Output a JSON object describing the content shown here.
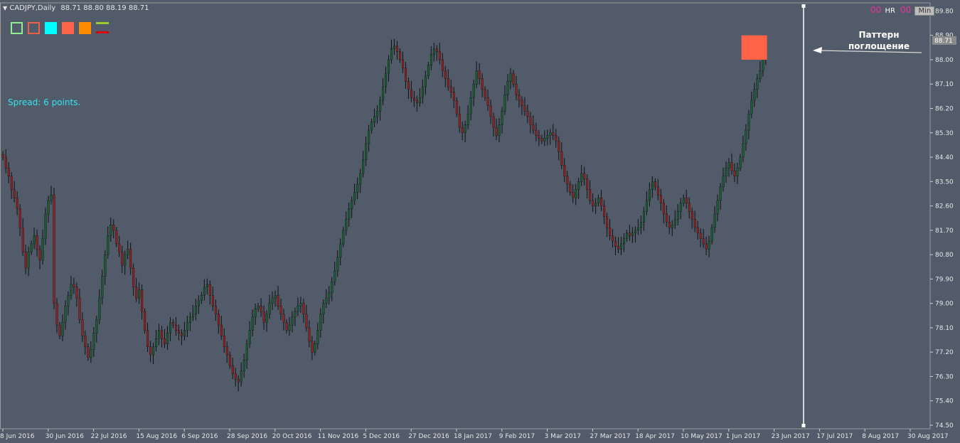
{
  "header": {
    "title": "CADJPY,Daily",
    "ohlc": "88.71 88.80 88.19 88.71"
  },
  "toolbar": {
    "buttons": [
      {
        "name": "green-outline-square",
        "color": "#90ee90",
        "style": "outline"
      },
      {
        "name": "red-outline-square",
        "color": "#f06048",
        "style": "outline"
      },
      {
        "name": "cyan-square",
        "color": "#00ffff",
        "style": "fill"
      },
      {
        "name": "tomato-square",
        "color": "#ff6347",
        "style": "fill"
      },
      {
        "name": "orange-square",
        "color": "#ff8c00",
        "style": "fill"
      },
      {
        "name": "lines-button",
        "colors": [
          "#9acd32",
          "#dd0000"
        ],
        "style": "lines"
      }
    ]
  },
  "spread": {
    "text": "Spread: 6 points."
  },
  "top_right": {
    "hr_counter": "00",
    "hr_label": "HR",
    "min_counter": "00",
    "min_label": "Min"
  },
  "annotation": {
    "line1": "Паттерн",
    "line2": "поглощение"
  },
  "current_price_label": "88.71",
  "colors": {
    "background": "#525b69",
    "bull": "#1a5c33",
    "bear": "#8e2222",
    "wick": "#101010",
    "pattern_box": "#ff6347",
    "vline": "#ffffff",
    "axis_text": "#e6e6e6",
    "spread_text": "#35e3f0",
    "counter_text": "#e8349b"
  },
  "chart_data": {
    "type": "candlestick",
    "title": "CADJPY,Daily",
    "y_ticks": [
      "89.80",
      "88.90",
      "88.00",
      "87.10",
      "86.20",
      "85.30",
      "84.40",
      "83.50",
      "82.60",
      "81.70",
      "80.80",
      "79.90",
      "79.00",
      "78.10",
      "77.20",
      "76.30",
      "75.40",
      "74.50"
    ],
    "ylim": [
      74.5,
      90.1
    ],
    "x_ticks": [
      "8 Jun 2016",
      "30 Jun 2016",
      "22 Jul 2016",
      "15 Aug 2016",
      "6 Sep 2016",
      "28 Sep 2016",
      "20 Oct 2016",
      "11 Nov 2016",
      "5 Dec 2016",
      "27 Dec 2016",
      "18 Jan 2017",
      "9 Feb 2017",
      "3 Mar 2017",
      "27 Mar 2017",
      "18 Apr 2017",
      "10 May 2017",
      "1 Jun 2017",
      "23 Jun 2017",
      "17 Jul 2017",
      "8 Aug 2017",
      "30 Aug 2017"
    ],
    "bars_between_ticks": 16,
    "series_close": [
      84.4,
      84.0,
      83.7,
      83.2,
      82.9,
      82.5,
      81.8,
      80.9,
      80.3,
      80.9,
      81.2,
      81.5,
      81.0,
      80.6,
      81.4,
      82.3,
      82.8,
      83.0,
      79.0,
      78.2,
      77.8,
      78.3,
      78.9,
      79.3,
      79.7,
      79.6,
      79.2,
      78.4,
      77.8,
      77.4,
      77.0,
      77.3,
      77.9,
      78.4,
      79.2,
      80.0,
      80.8,
      81.5,
      81.9,
      81.7,
      81.2,
      80.9,
      80.4,
      80.8,
      81.0,
      80.3,
      79.6,
      79.2,
      79.5,
      78.7,
      78.0,
      77.4,
      77.1,
      77.4,
      77.7,
      78.0,
      77.7,
      77.5,
      77.9,
      78.3,
      78.2,
      78.0,
      77.9,
      77.8,
      78.0,
      78.3,
      78.5,
      78.6,
      78.9,
      79.1,
      79.3,
      79.6,
      79.7,
      79.3,
      78.9,
      78.6,
      78.2,
      77.8,
      77.4,
      77.1,
      76.7,
      76.4,
      76.2,
      76.1,
      76.5,
      76.9,
      77.5,
      78.0,
      78.5,
      78.8,
      78.9,
      78.7,
      78.3,
      78.6,
      79.0,
      79.2,
      79.3,
      78.9,
      78.6,
      78.3,
      78.0,
      78.2,
      78.5,
      78.7,
      78.9,
      79.0,
      78.6,
      78.1,
      77.6,
      77.2,
      77.5,
      78.0,
      78.6,
      79.0,
      79.2,
      79.4,
      79.8,
      80.2,
      80.7,
      81.2,
      81.7,
      82.1,
      82.5,
      82.8,
      83.1,
      83.4,
      83.8,
      84.3,
      84.9,
      85.4,
      85.7,
      85.9,
      86.1,
      86.5,
      87.0,
      87.5,
      88.0,
      88.4,
      88.5,
      88.3,
      88.0,
      87.7,
      87.2,
      86.9,
      86.6,
      86.5,
      86.4,
      86.6,
      87.0,
      87.4,
      87.8,
      88.2,
      88.4,
      88.3,
      88.0,
      87.6,
      87.3,
      87.0,
      86.8,
      86.5,
      86.0,
      85.5,
      85.3,
      85.6,
      86.0,
      86.6,
      87.1,
      87.6,
      87.3,
      86.9,
      86.6,
      86.3,
      85.9,
      85.5,
      85.2,
      85.6,
      86.1,
      86.7,
      87.2,
      87.5,
      87.1,
      86.7,
      86.5,
      86.3,
      86.1,
      85.9,
      85.6,
      85.4,
      85.2,
      85.1,
      85.0,
      85.1,
      85.2,
      85.3,
      85.2,
      85.0,
      84.6,
      84.1,
      83.7,
      83.4,
      83.1,
      82.9,
      83.2,
      83.5,
      83.8,
      83.6,
      83.2,
      82.8,
      82.6,
      82.7,
      82.9,
      82.6,
      82.2,
      81.8,
      81.5,
      81.3,
      81.1,
      81.0,
      81.2,
      81.4,
      81.6,
      81.5,
      81.6,
      81.7,
      81.8,
      82.0,
      82.4,
      82.8,
      83.2,
      83.5,
      83.3,
      83.0,
      82.7,
      82.3,
      82.0,
      81.8,
      81.9,
      82.1,
      82.4,
      82.7,
      82.9,
      82.7,
      82.4,
      82.1,
      81.8,
      81.6,
      81.4,
      81.2,
      81.0,
      81.3,
      81.8,
      82.3,
      82.8,
      83.3,
      83.7,
      84.0,
      84.2,
      83.9,
      83.7,
      84.0,
      84.4,
      84.9,
      85.4,
      86.0,
      86.5,
      86.9,
      87.3,
      87.6,
      88.1,
      88.71
    ]
  }
}
